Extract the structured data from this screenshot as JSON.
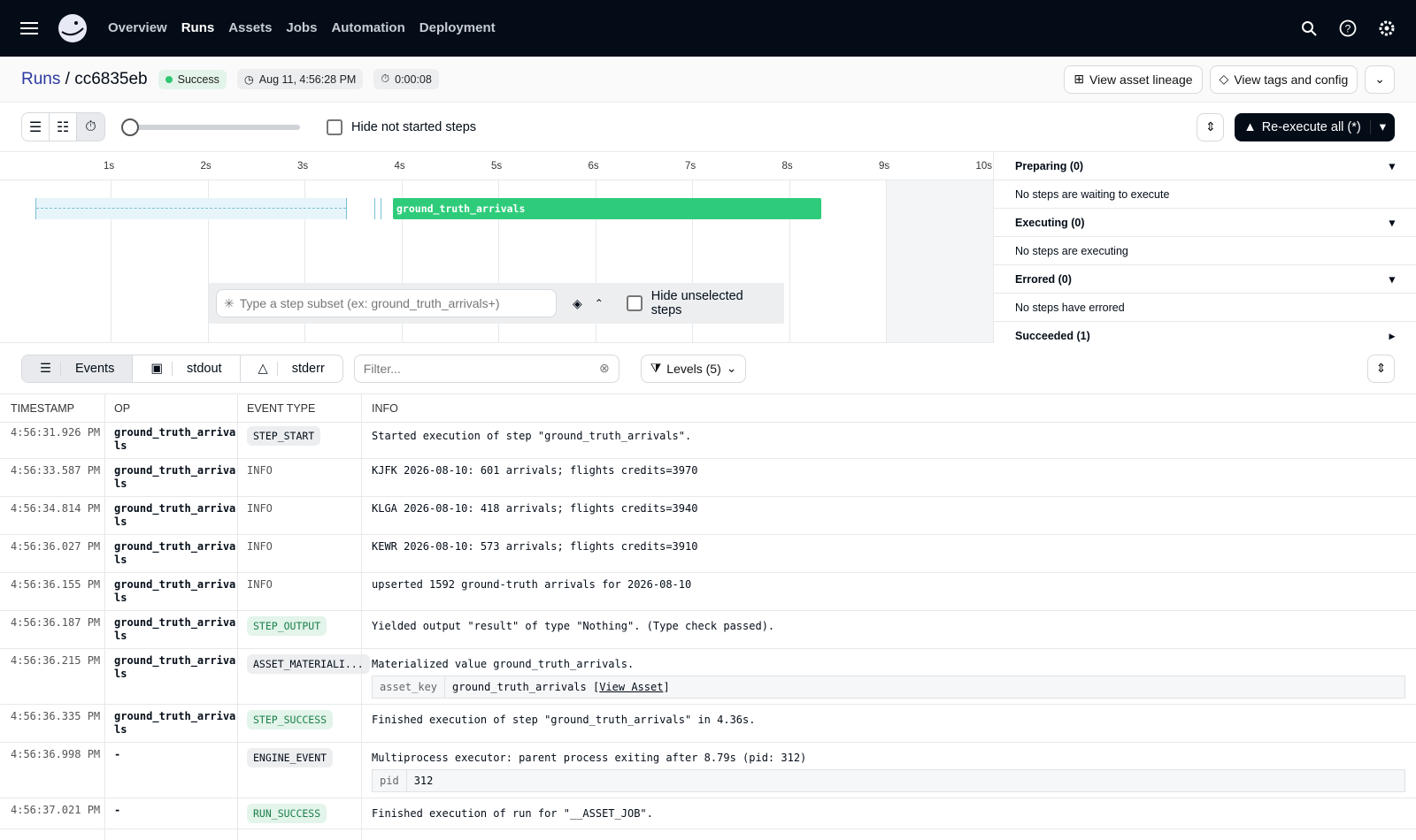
{
  "nav": {
    "items": [
      "Overview",
      "Runs",
      "Assets",
      "Jobs",
      "Automation",
      "Deployment"
    ],
    "active": "Runs"
  },
  "header": {
    "breadcrumb_root": "Runs",
    "run_id": "cc6835eb",
    "status": "Success",
    "started": "Aug 11, 4:56:28 PM",
    "duration": "0:00:08",
    "view_lineage": "View asset lineage",
    "view_tags": "View tags and config"
  },
  "toolbar": {
    "hide_not_started": "Hide not started steps",
    "reexecute": "Re-execute all (*)"
  },
  "gantt": {
    "ticks": [
      "1s",
      "2s",
      "3s",
      "4s",
      "5s",
      "6s",
      "7s",
      "8s",
      "9s",
      "10s"
    ],
    "step": "ground_truth_arrivals",
    "subset_placeholder": "Type a step subset (ex: ground_truth_arrivals+)",
    "hide_unselected": "Hide unselected steps"
  },
  "side": [
    {
      "title": "Preparing (0)",
      "body": "No steps are waiting to execute"
    },
    {
      "title": "Executing (0)",
      "body": "No steps are executing"
    },
    {
      "title": "Errored (0)",
      "body": "No steps have errored"
    },
    {
      "title": "Succeeded (1)",
      "body": ""
    }
  ],
  "logs": {
    "tabs": [
      "Events",
      "stdout",
      "stderr"
    ],
    "filter_placeholder": "Filter...",
    "levels": "Levels (5)",
    "headers": [
      "TIMESTAMP",
      "OP",
      "EVENT TYPE",
      "INFO"
    ],
    "rows": [
      {
        "ts": "4:56:31.926 PM",
        "op": "ground_truth_arrivals",
        "type": "STEP_START",
        "style": "tag",
        "info": "Started execution of step \"ground_truth_arrivals\"."
      },
      {
        "ts": "4:56:33.587 PM",
        "op": "ground_truth_arrivals",
        "type": "INFO",
        "style": "plain",
        "info": "KJFK 2026-08-10: 601 arrivals; flights credits=3970"
      },
      {
        "ts": "4:56:34.814 PM",
        "op": "ground_truth_arrivals",
        "type": "INFO",
        "style": "plain",
        "info": "KLGA 2026-08-10: 418 arrivals; flights credits=3940"
      },
      {
        "ts": "4:56:36.027 PM",
        "op": "ground_truth_arrivals",
        "type": "INFO",
        "style": "plain",
        "info": "KEWR 2026-08-10: 573 arrivals; flights credits=3910"
      },
      {
        "ts": "4:56:36.155 PM",
        "op": "ground_truth_arrivals",
        "type": "INFO",
        "style": "plain",
        "info": "upserted 1592 ground-truth arrivals for 2026-08-10"
      },
      {
        "ts": "4:56:36.187 PM",
        "op": "ground_truth_arrivals",
        "type": "STEP_OUTPUT",
        "style": "g",
        "info": "Yielded output \"result\" of type \"Nothing\". (Type check passed)."
      },
      {
        "ts": "4:56:36.215 PM",
        "op": "ground_truth_arrivals",
        "type": "ASSET_MATERIALI...",
        "style": "tag",
        "info": "Materialized value ground_truth_arrivals.",
        "kv": {
          "k": "asset_key",
          "v": "ground_truth_arrivals [",
          "link": "View Asset",
          "tail": "]"
        }
      },
      {
        "ts": "4:56:36.335 PM",
        "op": "ground_truth_arrivals",
        "type": "STEP_SUCCESS",
        "style": "g",
        "info": "Finished execution of step \"ground_truth_arrivals\" in 4.36s."
      },
      {
        "ts": "4:56:36.998 PM",
        "op": "-",
        "type": "ENGINE_EVENT",
        "style": "tag",
        "info": "Multiprocess executor: parent process exiting after 8.79s (pid: 312)",
        "kv": {
          "k": "pid",
          "v": "312",
          "link": "",
          "tail": ""
        }
      },
      {
        "ts": "4:56:37.021 PM",
        "op": "-",
        "type": "RUN_SUCCESS",
        "style": "g",
        "info": "Finished execution of run for \"__ASSET_JOB\"."
      }
    ]
  }
}
